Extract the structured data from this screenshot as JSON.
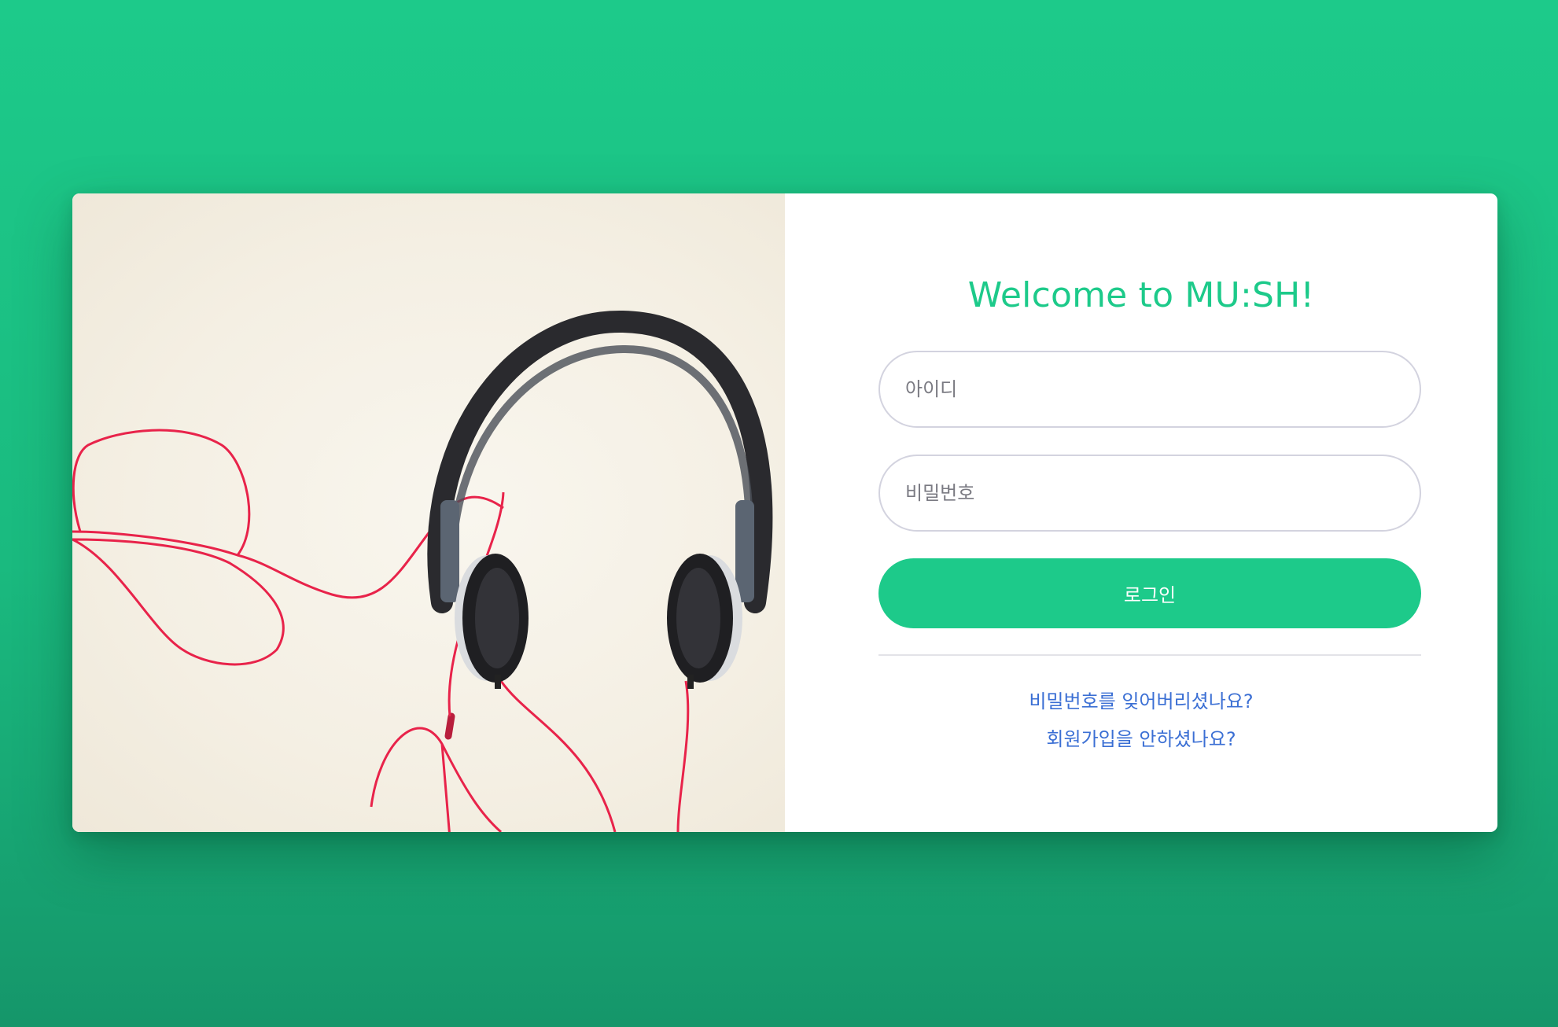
{
  "login": {
    "title": "Welcome to MU:SH!",
    "id_placeholder": "아이디",
    "password_placeholder": "비밀번호",
    "login_button": "로그인",
    "forgot_password_link": "비밀번호를 잊어버리셨나요?",
    "signup_link": "회원가입을 안하셨나요?"
  },
  "theme": {
    "accent": "#1dca8a",
    "link": "#3b6fd4",
    "background": "#1dca8a",
    "card": "#ffffff"
  },
  "image": {
    "icon": "headphones-photo"
  }
}
